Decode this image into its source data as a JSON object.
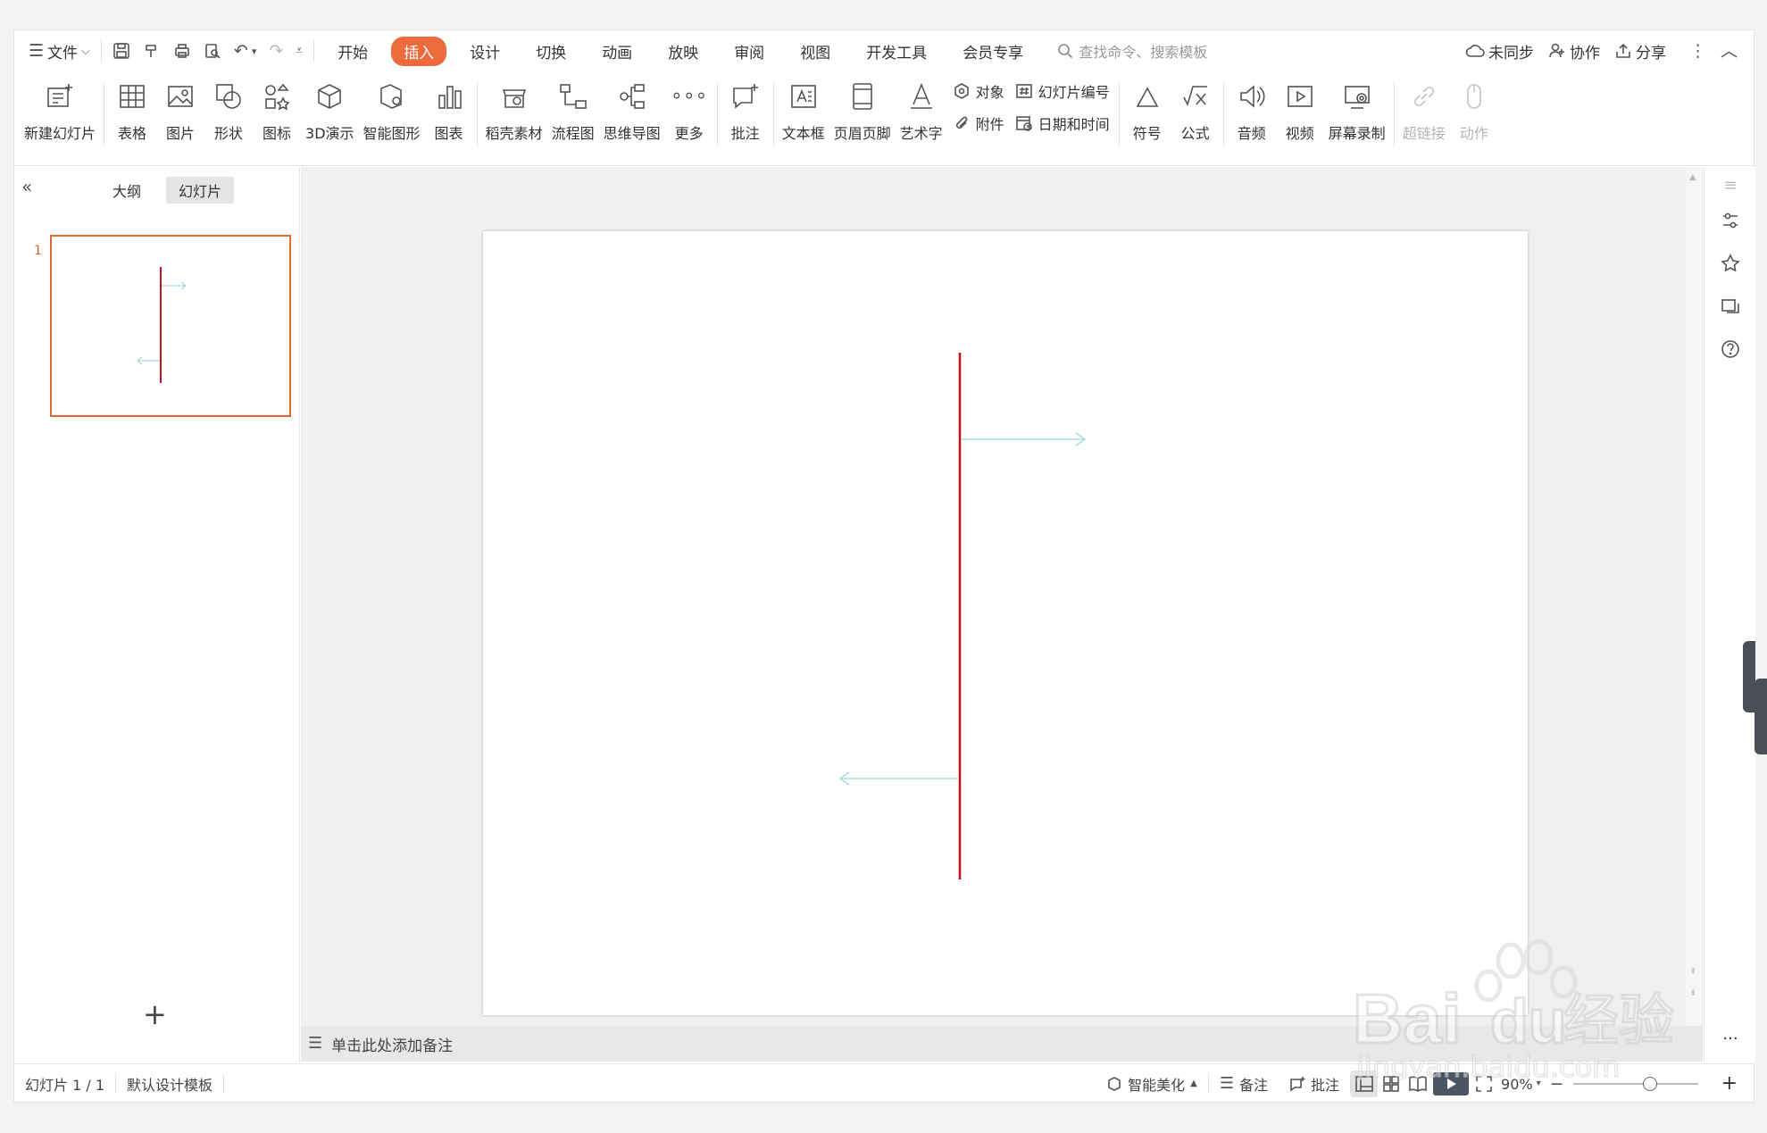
{
  "menubar": {
    "file_label": "文件",
    "tabs": [
      {
        "label": "开始",
        "active": false
      },
      {
        "label": "插入",
        "active": true
      },
      {
        "label": "设计",
        "active": false
      },
      {
        "label": "切换",
        "active": false
      },
      {
        "label": "动画",
        "active": false
      },
      {
        "label": "放映",
        "active": false
      },
      {
        "label": "审阅",
        "active": false
      },
      {
        "label": "视图",
        "active": false
      },
      {
        "label": "开发工具",
        "active": false
      },
      {
        "label": "会员专享",
        "active": false
      }
    ],
    "search_placeholder": "查找命令、搜索模板",
    "sync_label": "未同步",
    "collab_label": "协作",
    "share_label": "分享"
  },
  "ribbon": {
    "new_slide": "新建幻灯片",
    "table": "表格",
    "picture": "图片",
    "shape": "形状",
    "icon": "图标",
    "3d": "3D演示",
    "smartart": "智能图形",
    "chart": "图表",
    "daoke": "稻壳素材",
    "flowchart": "流程图",
    "mindmap": "思维导图",
    "more": "更多",
    "comment": "批注",
    "textbox": "文本框",
    "header_footer": "页眉页脚",
    "wordart": "艺术字",
    "object": "对象",
    "attachment": "附件",
    "slide_number": "幻灯片编号",
    "datetime": "日期和时间",
    "symbol": "符号",
    "formula": "公式",
    "audio": "音频",
    "video": "视频",
    "screen_record": "屏幕录制",
    "hyperlink": "超链接",
    "action": "动作"
  },
  "left_panel": {
    "tab_outline": "大纲",
    "tab_slides": "幻灯片",
    "slide_number": "1"
  },
  "notes_placeholder": "单击此处添加备注",
  "statusbar": {
    "slide_info": "幻灯片 1 / 1",
    "template": "默认设计模板",
    "beautify": "智能美化",
    "notes": "备注",
    "comment": "批注",
    "zoom": "90%",
    "zoom_value": 0.9
  },
  "slide_content": {
    "vertical_line_color": "#c0141c",
    "arrow_color": "#a9dde0"
  },
  "watermark": {
    "brand": "Bai",
    "brand_tail": "du",
    "cn": "经验",
    "url": "jingyan.baidu.com"
  },
  "colors": {
    "accent": "#ec6a3c",
    "thumb_border": "#e0672f"
  }
}
